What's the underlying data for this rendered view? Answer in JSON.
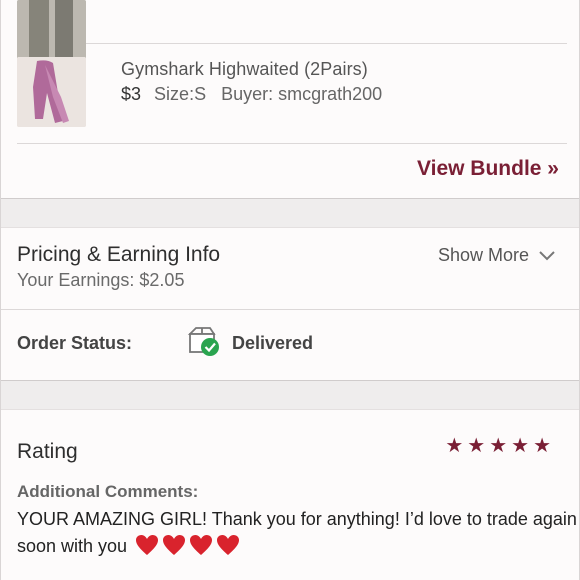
{
  "items": [
    {
      "title": "",
      "price": "",
      "size": "",
      "buyer": ""
    },
    {
      "title": "Gymshark Highwaited (2Pairs)",
      "price": "$3",
      "size": "Size:S",
      "buyer": "Buyer: smcgrath200"
    }
  ],
  "bundle": {
    "view_label": "View Bundle »"
  },
  "pricing": {
    "title": "Pricing & Earning Info",
    "earnings": "Your Earnings: $2.05",
    "show_more": "Show More"
  },
  "order": {
    "label": "Order Status:",
    "status": "Delivered"
  },
  "rating": {
    "title": "Rating",
    "stars": 5,
    "comments_label": "Additional Comments:",
    "comment": "YOUR AMAZING GIRL! Thank you for anything! I’d love to trade again soon with you"
  },
  "colors": {
    "accent": "#7a1f35",
    "success": "#2aa44f",
    "heart": "#d9232d"
  }
}
